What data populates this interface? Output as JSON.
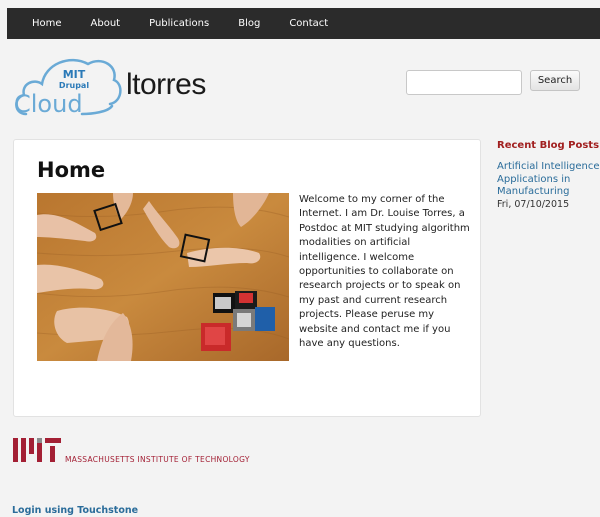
{
  "nav": {
    "items": [
      {
        "label": "Home"
      },
      {
        "label": "About"
      },
      {
        "label": "Publications"
      },
      {
        "label": "Blog"
      },
      {
        "label": "Contact"
      }
    ]
  },
  "logo": {
    "line1": "MIT",
    "line2": "Drupal",
    "line3": "Cloud"
  },
  "site_name": "ltorres",
  "search": {
    "button_label": "Search",
    "value": ""
  },
  "main": {
    "title": "Home",
    "intro": "Welcome to my corner of the Internet. I am Dr. Louise Torres, a Postdoc at MIT studying algorithm modalities on artificial intelligence. I welcome opportunities to collaborate on research projects or to speak on my past and current research projects. Please peruse my website and contact me if you have any questions."
  },
  "sidebar": {
    "heading": "Recent Blog Posts",
    "posts": [
      {
        "title": "Artificial Intelligence Applications in Manufacturing",
        "date": "Fri, 07/10/2015"
      }
    ]
  },
  "footer": {
    "institute_name": "MASSACHUSETTS INSTITUTE OF TECHNOLOGY",
    "login_label": "Login using Touchstone"
  },
  "colors": {
    "nav_bg": "#2b2b2b",
    "accent_red": "#a11f1f",
    "link_blue": "#2a6c9a",
    "cloud_blue": "#6aaad6"
  }
}
